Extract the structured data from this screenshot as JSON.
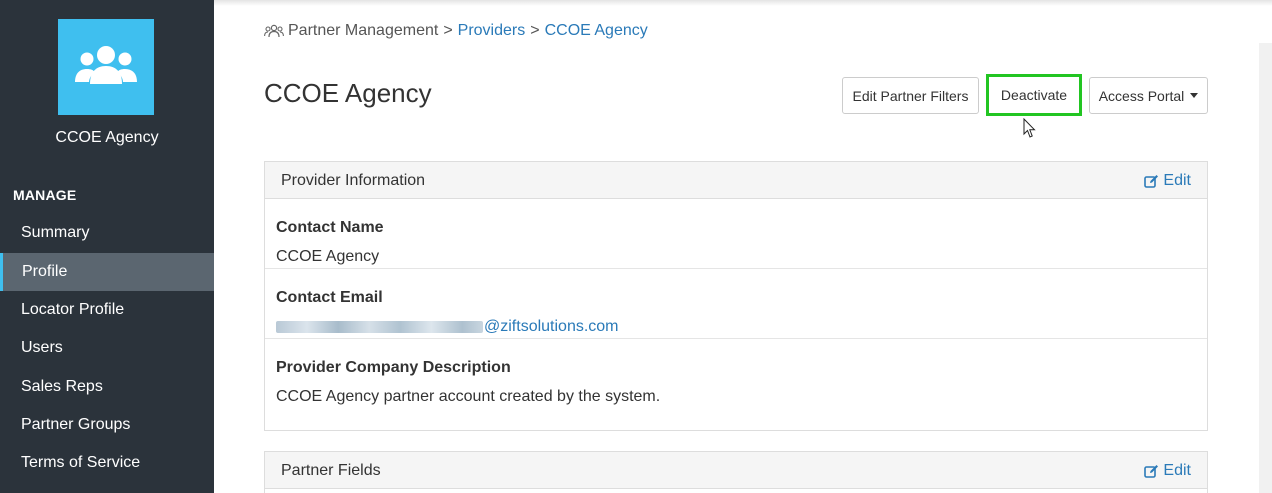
{
  "sidebar": {
    "org_name": "CCOE Agency",
    "section_label": "MANAGE",
    "items": [
      {
        "label": "Summary",
        "active": false
      },
      {
        "label": "Profile",
        "active": true
      },
      {
        "label": "Locator Profile",
        "active": false
      },
      {
        "label": "Users",
        "active": false
      },
      {
        "label": "Sales Reps",
        "active": false
      },
      {
        "label": "Partner Groups",
        "active": false
      },
      {
        "label": "Terms of Service",
        "active": false
      }
    ]
  },
  "breadcrumb": {
    "icon": "partners-icon",
    "root": "Partner Management",
    "separator": ">",
    "items": [
      "Providers",
      "CCOE Agency"
    ]
  },
  "page": {
    "title": "CCOE Agency"
  },
  "actions": {
    "edit_filters": "Edit Partner Filters",
    "deactivate": "Deactivate",
    "access_portal": "Access Portal"
  },
  "provider_info": {
    "heading": "Provider Information",
    "edit_label": "Edit",
    "fields": [
      {
        "label": "Contact Name",
        "value": "CCOE Agency"
      },
      {
        "label": "Contact Email",
        "value": "@ziftsolutions.com"
      },
      {
        "label": "Provider Company Description",
        "value": "CCOE Agency partner account created by the system."
      }
    ]
  },
  "partner_fields": {
    "heading": "Partner Fields",
    "edit_label": "Edit"
  },
  "colors": {
    "sidebar_bg": "#2b333b",
    "accent": "#3fbfef",
    "link": "#2a7ab8",
    "highlight_border": "#22c522"
  }
}
